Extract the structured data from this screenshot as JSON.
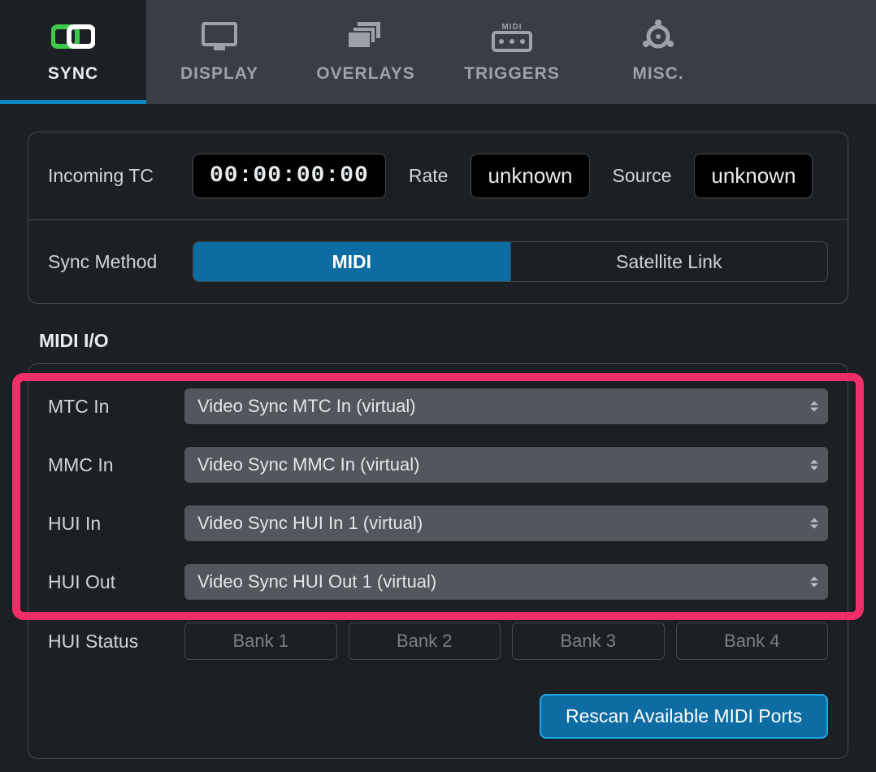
{
  "tabs": [
    {
      "id": "sync",
      "label": "SYNC",
      "icon": "sync-icon",
      "active": true
    },
    {
      "id": "display",
      "label": "DISPLAY",
      "icon": "display-icon",
      "active": false
    },
    {
      "id": "overlays",
      "label": "OVERLAYS",
      "icon": "overlays-icon",
      "active": false
    },
    {
      "id": "triggers",
      "label": "TRIGGERS",
      "icon": "midi-icon",
      "active": false
    },
    {
      "id": "misc",
      "label": "MISC.",
      "icon": "gear-icon",
      "active": false
    }
  ],
  "incoming": {
    "label": "Incoming TC",
    "timecode": "00:00:00:00",
    "rate_label": "Rate",
    "rate_value": "unknown",
    "source_label": "Source",
    "source_value": "unknown"
  },
  "sync_method": {
    "label": "Sync Method",
    "options": [
      "MIDI",
      "Satellite Link"
    ],
    "selected": "MIDI"
  },
  "midi_io": {
    "heading": "MIDI I/O",
    "rows": [
      {
        "label": "MTC In",
        "value": "Video Sync MTC In (virtual)"
      },
      {
        "label": "MMC In",
        "value": "Video Sync MMC In (virtual)"
      },
      {
        "label": "HUI In",
        "value": "Video Sync HUI In 1 (virtual)"
      },
      {
        "label": "HUI Out",
        "value": "Video Sync HUI Out 1 (virtual)"
      }
    ],
    "hui_status": {
      "label": "HUI Status",
      "banks": [
        "Bank 1",
        "Bank 2",
        "Bank 3",
        "Bank 4"
      ]
    },
    "rescan_label": "Rescan Available MIDI Ports"
  }
}
